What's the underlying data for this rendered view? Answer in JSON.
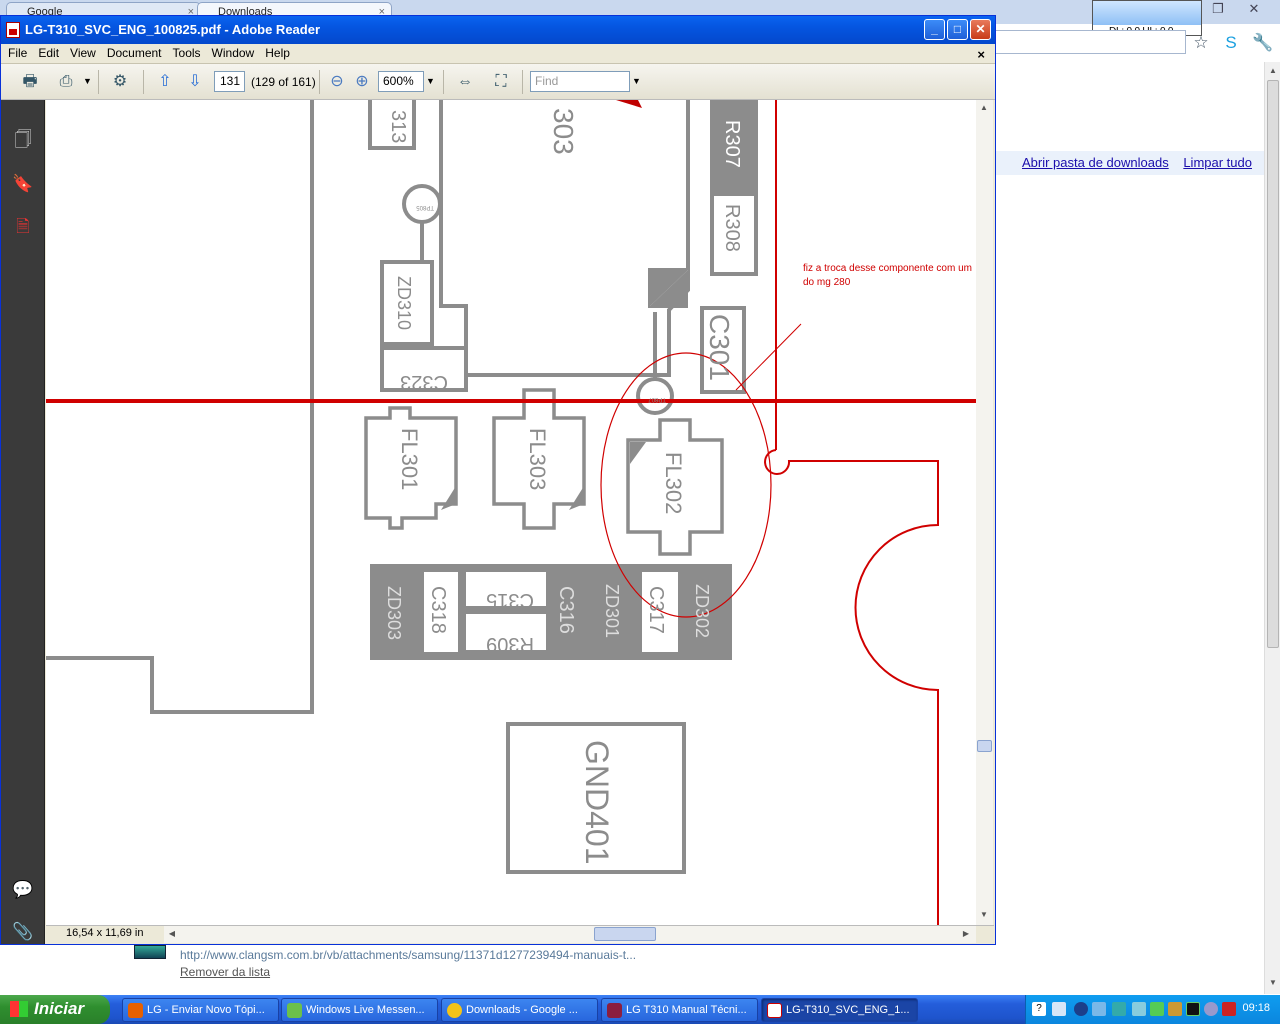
{
  "chrome": {
    "tabs": [
      {
        "label": "Google"
      },
      {
        "label": "Downloads"
      }
    ],
    "net_meter": "DL: 0.0 UL: 0.0",
    "downloads_links": {
      "open_folder": "Abrir pasta de downloads",
      "clear_all": "Limpar tudo"
    },
    "download_item": {
      "url": "http://www.clangsm.com.br/vb/attachments/samsung/11371d1277239494-manuais-t...",
      "remove": "Remover da lista"
    }
  },
  "reader": {
    "title": "LG-T310_SVC_ENG_100825.pdf - Adobe Reader",
    "menu": [
      "File",
      "Edit",
      "View",
      "Document",
      "Tools",
      "Window",
      "Help"
    ],
    "page_number": "131",
    "page_of": "(129 of 161)",
    "zoom": "600%",
    "find_placeholder": "Find",
    "page_size": "16,54 x 11,69 in"
  },
  "schematic": {
    "labels": {
      "r313_partial": "313",
      "u303_partial": "303",
      "r307": "R307",
      "r308": "R308",
      "tp805": "TP805",
      "zd310": "ZD310",
      "c323": "C323",
      "c301": "C301",
      "tp807": "TP807",
      "fl301": "FL301",
      "fl303": "FL303",
      "fl302": "FL302",
      "zd303": "ZD303",
      "c318": "C318",
      "c315": "C315",
      "r309": "R309",
      "c316": "C316",
      "zd301": "ZD301",
      "c317": "C317",
      "zd302": "ZD302",
      "gnd401": "GND401"
    },
    "annotation": "fiz a troca desse componente com um do mg 280"
  },
  "taskbar": {
    "start": "Iniciar",
    "tasks": [
      "LG - Enviar Novo Tópi...",
      "Windows Live Messen...",
      "Downloads - Google ...",
      "LG T310 Manual Técni...",
      "LG-T310_SVC_ENG_1..."
    ],
    "clock": "09:18"
  },
  "colors": {
    "part_gray": "#8c8c8c",
    "annotation_red": "#d00000",
    "xp_blue": "#0555e0"
  }
}
